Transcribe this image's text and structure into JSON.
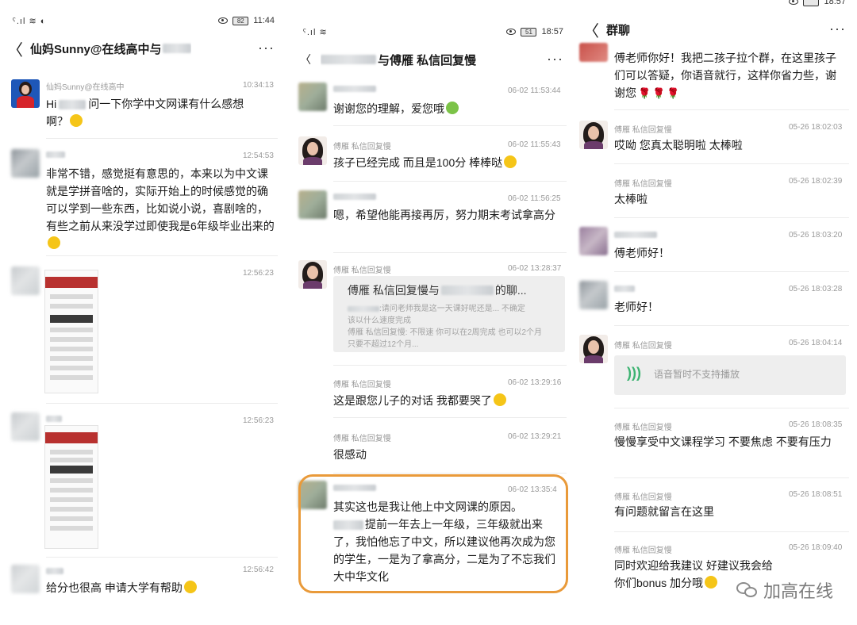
{
  "panel1": {
    "status": {
      "left": "ˤ.ıl ≋ ◐",
      "battery": "82",
      "time": "11:44"
    },
    "header": {
      "back": "〈",
      "title": "仙妈Sunny@在线高中与",
      "more": "···"
    },
    "messages": [
      {
        "name": "仙妈Sunny@在线高中",
        "time": "10:34:13",
        "text_a": "Hi",
        "text_b": "问一下你学中文网课有什么感想",
        "text_c": "啊？"
      },
      {
        "time": "12:54:53",
        "text": "非常不错，感觉挺有意思的，本来以为中文课就是学拼音啥的，实际开始上的时候感觉的确可以学到一些东西，比如说小说，喜剧啥的，有些之前从来没学过即使我是6年级毕业出来的"
      },
      {
        "time": "12:56:23"
      },
      {
        "time": "12:56:23"
      },
      {
        "time": "12:56:42",
        "text": "给分也很高 申请大学有帮助"
      }
    ]
  },
  "panel2": {
    "status": {
      "left": "ˤ.ıl ≋",
      "battery": "51",
      "time": "18:57"
    },
    "header": {
      "back": "〈",
      "title": "与傅雁 私信回复慢",
      "more": "···"
    },
    "messages": [
      {
        "time": "06-02 11:53:44",
        "text": "谢谢您的理解，爱您哦"
      },
      {
        "name": "傅雁 私信回复慢",
        "time": "06-02 11:55:43",
        "text": "孩子已经完成 而且是100分 棒棒哒"
      },
      {
        "time": "06-02 11:56:25",
        "text": "嗯，希望他能再接再厉，努力期末考试拿高分"
      },
      {
        "name": "傅雁 私信回复慢",
        "time": "06-02 13:28:37",
        "quote_title_a": "傅雁 私信回复慢与",
        "quote_title_b": "的聊...",
        "quote_lines": [
          ":请问老师我是这一天课好呢还是... 不确定",
          "该以什么速度完成",
          "傅雁 私信回复慢: 不限速 你可以在2周完成 也可以2个月",
          "只要不超过12个月..."
        ]
      },
      {
        "name": "傅雁 私信回复慢",
        "time": "06-02 13:29:16",
        "text": "这是跟您儿子的对话 我都要哭了"
      },
      {
        "name": "傅雁 私信回复慢",
        "time": "06-02 13:29:21",
        "text": "很感动"
      },
      {
        "time": "06-02 13:35:4",
        "text_a": "其实这也是我让他上中文网课的原因。",
        "text_b": "提前一年去上一年级，三年级就出来了，我怕他忘了中文，所以建议他再次成为您的学生，一是为了拿高分，二是为了不忘我们大中华文化"
      }
    ]
  },
  "panel3": {
    "status": {
      "time": "18:57"
    },
    "header": {
      "back": "〈",
      "title": "群聊",
      "more": "···"
    },
    "messages": [
      {
        "text": "傅老师你好！我把二孩子拉个群，在这里孩子们可以答疑，你语音就行，这样你省力些，谢谢您"
      },
      {
        "name": "傅雁 私信回复慢",
        "time": "05-26 18:02:03",
        "text": "哎呦 您真太聪明啦 太棒啦"
      },
      {
        "name": "傅雁 私信回复慢",
        "time": "05-26 18:02:39",
        "text": "太棒啦"
      },
      {
        "time": "05-26 18:03:20",
        "text": "傅老师好！"
      },
      {
        "time": "05-26 18:03:28",
        "text": "老师好！"
      },
      {
        "name": "傅雁 私信回复慢",
        "time": "05-26 18:04:14",
        "voice": "语音暂时不支持播放"
      },
      {
        "name": "傅雁 私信回复慢",
        "time": "05-26 18:08:35",
        "text": "慢慢享受中文课程学习 不要焦虑 不要有压力"
      },
      {
        "name": "傅雁 私信回复慢",
        "time": "05-26 18:08:51",
        "text": "有问题就留言在这里"
      },
      {
        "name": "傅雁 私信回复慢",
        "time": "05-26 18:09:40",
        "text": "同时欢迎给我建议 好建议我会给你们bonus 加分哦"
      }
    ]
  },
  "watermark": {
    "text": "加高在线"
  },
  "colors": {
    "highlight": "#e99a3a",
    "voice_wave": "#3cb371",
    "name_gray": "#9a9a9a"
  }
}
